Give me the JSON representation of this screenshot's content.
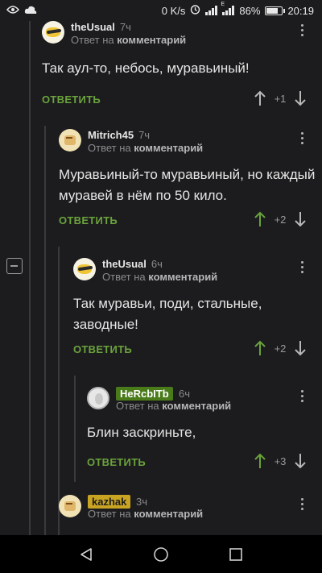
{
  "statusbar": {
    "speed": "0 K/s",
    "battery": "86%",
    "time": "20:19",
    "network_label": "E"
  },
  "comments": [
    {
      "author": "theUsual",
      "age": "7ч",
      "reply_prefix": "Ответ на",
      "reply_target": "комментарий",
      "text": "Так аул-то, небось, муравьиный!",
      "reply_label": "ОТВЕТИТЬ",
      "score": "+1",
      "voted": false
    },
    {
      "author": "Mitrich45",
      "age": "7ч",
      "reply_prefix": "Ответ на",
      "reply_target": "комментарий",
      "text": "Муравьиный-то муравьиный, но каждый муравей в нём по 50 кило.",
      "reply_label": "ОТВЕТИТЬ",
      "score": "+2",
      "voted": true
    },
    {
      "author": "theUsual",
      "age": "6ч",
      "reply_prefix": "Ответ на",
      "reply_target": "комментарий",
      "text": "Так муравьи, поди, стальные, заводные!",
      "reply_label": "ОТВЕТИТЬ",
      "score": "+2",
      "voted": true
    },
    {
      "author": "HeRcbITb",
      "age": "6ч",
      "reply_prefix": "Ответ на",
      "reply_target": "комментарий",
      "text": "Блин заскриньте,",
      "reply_label": "ОТВЕТИТЬ",
      "score": "+3",
      "voted": true
    },
    {
      "author": "kazhak",
      "age": "3ч",
      "reply_prefix": "Ответ на",
      "reply_target": "комментарий"
    }
  ],
  "colors": {
    "background": "#1c1c1e",
    "accent_green": "#6aa33c",
    "badge_green": "#4a7b1b",
    "badge_gold": "#c9a422"
  },
  "icons": [
    "eye-icon",
    "cloud-icon",
    "alarm-icon",
    "signal-icon",
    "battery-icon",
    "more-icon",
    "upvote-icon",
    "downvote-icon",
    "back-icon",
    "home-icon",
    "recents-icon",
    "collapse-icon"
  ]
}
